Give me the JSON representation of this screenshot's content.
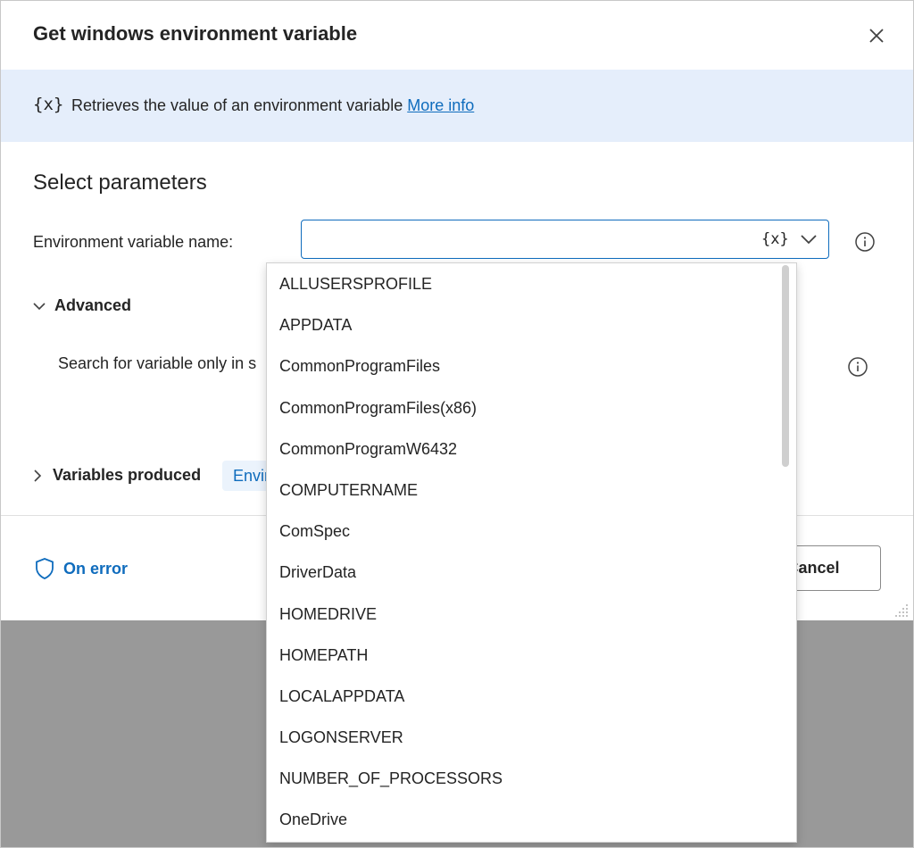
{
  "dialog": {
    "title": "Get windows environment variable"
  },
  "banner": {
    "icon_text": "{x}",
    "description": "Retrieves the value of an environment variable",
    "link_label": "More info"
  },
  "parameters": {
    "section_title": "Select parameters",
    "env_var_label": "Environment variable name:",
    "env_var_value": "",
    "var_icon_text": "{x}"
  },
  "advanced": {
    "label": "Advanced",
    "search_option_label": "Search for variable only in s"
  },
  "variables_produced": {
    "label": "Variables produced",
    "chip_label": "Envir"
  },
  "footer": {
    "on_error_label": "On error",
    "cancel_label": "Cancel"
  },
  "dropdown": {
    "options": [
      "ALLUSERSPROFILE",
      "APPDATA",
      "CommonProgramFiles",
      "CommonProgramFiles(x86)",
      "CommonProgramW6432",
      "COMPUTERNAME",
      "ComSpec",
      "DriverData",
      "HOMEDRIVE",
      "HOMEPATH",
      "LOCALAPPDATA",
      "LOGONSERVER",
      "NUMBER_OF_PROCESSORS",
      "OneDrive"
    ]
  },
  "colors": {
    "accent": "#0f6cbd",
    "banner_bg": "#e5eefb",
    "backdrop": "#999999"
  },
  "icons": {
    "close": "close-icon",
    "chevron": "chevron-down-icon",
    "info": "info-icon",
    "shield": "shield-icon"
  }
}
